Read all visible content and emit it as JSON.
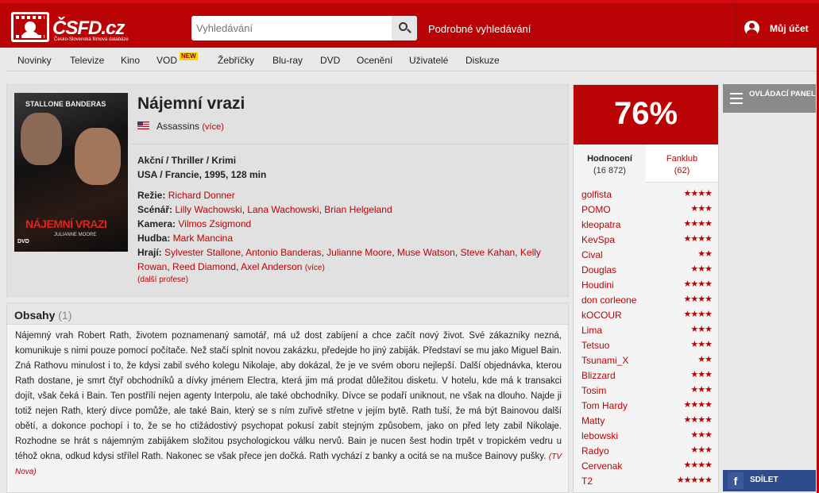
{
  "header": {
    "logo_text": "ČSFD",
    "logo_suffix": ".cz",
    "logo_subtitle": "Česko-Slovenská filmová databáze",
    "search_placeholder": "Vyhledávání",
    "advanced_search": "Podrobné vyhledávání",
    "account": "Můj účet"
  },
  "nav": {
    "items": [
      "Novinky",
      "Televize",
      "Kino",
      "VOD",
      "Žebříčky",
      "Blu-ray",
      "DVD",
      "Ocenění",
      "Uživatelé",
      "Diskuze"
    ],
    "new_badge": "NEW"
  },
  "film": {
    "poster_names": "STALLONE   BANDERAS",
    "poster_title": "NÁJEMNÍ VRAZI",
    "poster_actor": "JULIANNE MOORE",
    "poster_dvd": "DVD",
    "title": "Nájemní vrazi",
    "alt_title": "Assassins",
    "alt_more": "(více)",
    "genres": "Akční / Thriller / Krimi",
    "origin": "USA / Francie, 1995, 128 min",
    "directing_label": "Režie:",
    "directing": [
      "Richard Donner"
    ],
    "screenplay_label": "Scénář:",
    "screenplay": [
      "Lilly Wachowski",
      "Lana Wachowski",
      "Brian Helgeland"
    ],
    "camera_label": "Kamera:",
    "camera": [
      "Vilmos Zsigmond"
    ],
    "music_label": "Hudba:",
    "music": [
      "Mark Mancina"
    ],
    "cast_label": "Hrají:",
    "cast": [
      "Sylvester Stallone",
      "Antonio Banderas",
      "Julianne Moore",
      "Muse Watson",
      "Steve Kahan",
      "Kelly Rowan",
      "Reed Diamond",
      "Axel Anderson"
    ],
    "cast_more": "(více)",
    "more_professions": "(další profese)"
  },
  "plot": {
    "heading": "Obsahy",
    "count": "(1)",
    "text": "Nájemný vrah Robert Rath, životem poznamenaný samotář, má už dost zabíjení a chce začít nový život. Své zákazníky nezná, komunikuje s nimi pouze pomocí počítače. Než stačí splnit novou zakázku, předejde ho jiný zabiják. Představí se mu jako Miguel Bain. Zná Rathovu minulost i to, že kdysi zabil svého kolegu Nikolaje, aby dokázal, že je ve svém oboru nejlepší. Další objednávka, kterou Rath dostane, je smrt čtyř obchodníků a dívky jménem Electra, která jim má prodat důležitou disketu. V hotelu, kde má k transakci dojít, však čeká i Bain. Ten postřílí nejen agenty Interpolu, ale také obchodníky. Dívce se podaří uniknout, ne však na dlouho. Najde ji totiž nejen Rath, který dívce pomůže, ale také Bain, který se s ním zuřivě střetne v jejím bytě. Rath tuší, že má být Bainovou další obětí, a dokonce pochopí i to, že se ho ctižádostivý psychopat pokusí zabít stejným způsobem, jako on před lety zabil Nikolaje. Rozhodne se hrát s nájemným zabijákem složitou psychologickou válku nervů. Bain je nucen šest hodin trpět v tropickém vedru u téhož okna, odkud kdysi střílel Rath. Nakonec se však přece jen dočká. Rath vychází z banky a ocitá se na mušce Bainovy pušky.",
    "source": "(TV Nova)"
  },
  "rating": {
    "value": "76%",
    "tab_ratings": "Hodnocení",
    "tab_ratings_count": "(16 872)",
    "tab_fanclub": "Fanklub",
    "tab_fanclub_count": "(62)",
    "users": [
      {
        "name": "golfista",
        "stars": "★★★★"
      },
      {
        "name": "POMO",
        "stars": "★★★"
      },
      {
        "name": "kleopatra",
        "stars": "★★★★"
      },
      {
        "name": "KevSpa",
        "stars": "★★★★"
      },
      {
        "name": "Cival",
        "stars": "★★"
      },
      {
        "name": "Douglas",
        "stars": "★★★"
      },
      {
        "name": "Houdini",
        "stars": "★★★★"
      },
      {
        "name": "don corleone",
        "stars": "★★★★"
      },
      {
        "name": "kOCOUR",
        "stars": "★★★★"
      },
      {
        "name": "Lima",
        "stars": "★★★"
      },
      {
        "name": "Tetsuo",
        "stars": "★★★"
      },
      {
        "name": "Tsunami_X",
        "stars": "★★"
      },
      {
        "name": "Blizzard",
        "stars": "★★★"
      },
      {
        "name": "Tosim",
        "stars": "★★★"
      },
      {
        "name": "Tom Hardy",
        "stars": "★★★★"
      },
      {
        "name": "Matty",
        "stars": "★★★★"
      },
      {
        "name": "lebowski",
        "stars": "★★★"
      },
      {
        "name": "Radyo",
        "stars": "★★★"
      },
      {
        "name": "Cervenak",
        "stars": "★★★★"
      },
      {
        "name": "T2",
        "stars": "★★★★★"
      }
    ]
  },
  "sidebar": {
    "control_panel": "OVLÁDACÍ PANEL",
    "share": "SDÍLET",
    "fb_letter": "f"
  }
}
